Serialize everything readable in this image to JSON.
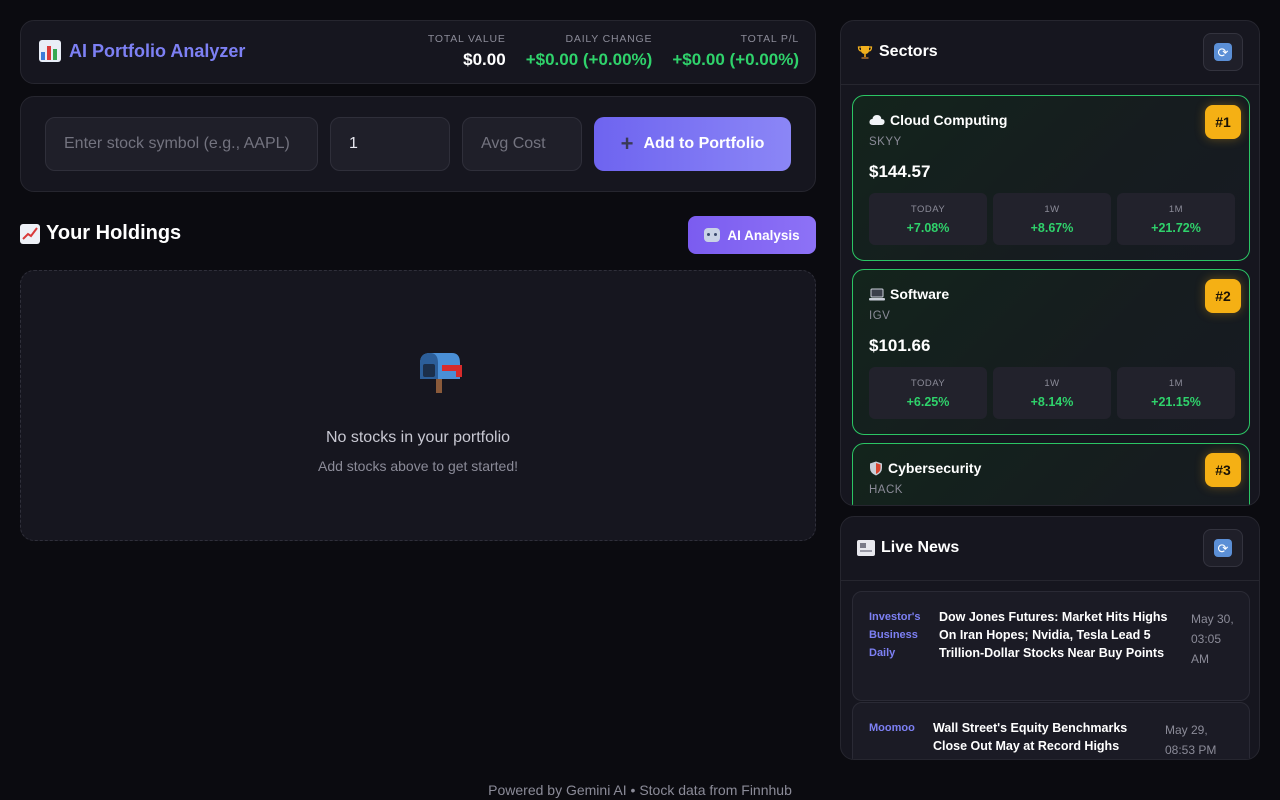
{
  "header": {
    "title": "AI Portfolio Analyzer",
    "stats": [
      {
        "label": "TOTAL VALUE",
        "value": "$0.00",
        "color": "#ffffff"
      },
      {
        "label": "DAILY CHANGE",
        "value": "+$0.00 (+0.00%)",
        "color": "#2fd26b"
      },
      {
        "label": "TOTAL P/L",
        "value": "+$0.00 (+0.00%)",
        "color": "#2fd26b"
      }
    ]
  },
  "add_form": {
    "symbol_placeholder": "Enter stock symbol (e.g., AAPL)",
    "quantity_value": "1",
    "avg_cost_placeholder": "Avg Cost",
    "add_button_label": "Add to Portfolio"
  },
  "holdings": {
    "title": "Your Holdings",
    "ai_button_label": "AI Analysis",
    "empty_title": "No stocks in your portfolio",
    "empty_subtitle": "Add stocks above to get started!"
  },
  "sectors": {
    "title": "Sectors",
    "items": [
      {
        "name": "Cloud Computing",
        "icon": "cloud-icon",
        "ticker": "SKYY",
        "price": "$144.57",
        "rank": "#1",
        "perf": [
          {
            "label": "TODAY",
            "value": "+7.08%"
          },
          {
            "label": "1W",
            "value": "+8.67%"
          },
          {
            "label": "1M",
            "value": "+21.72%"
          }
        ]
      },
      {
        "name": "Software",
        "icon": "laptop-icon",
        "ticker": "IGV",
        "price": "$101.66",
        "rank": "#2",
        "perf": [
          {
            "label": "TODAY",
            "value": "+6.25%"
          },
          {
            "label": "1W",
            "value": "+8.14%"
          },
          {
            "label": "1M",
            "value": "+21.15%"
          }
        ]
      },
      {
        "name": "Cybersecurity",
        "icon": "shield-icon",
        "ticker": "HACK",
        "rank": "#3"
      }
    ]
  },
  "news": {
    "title": "Live News",
    "items": [
      {
        "source": "Investor's Business Daily",
        "title": "Dow Jones Futures: Market Hits Highs On Iran Hopes; Nvidia, Tesla Lead 5 Trillion-Dollar Stocks Near Buy Points",
        "time": "May 30, 03:05 AM"
      },
      {
        "source": "Moomoo",
        "title": "Wall Street's Equity Benchmarks Close Out May at Record Highs",
        "time": "May 29, 08:53 PM"
      }
    ]
  },
  "footer": {
    "text": "Powered by Gemini AI • Stock data from Finnhub"
  },
  "colors": {
    "accent": "#7d80f4",
    "positive": "#2fd26b",
    "rank_badge": "#f5b014",
    "sector_border": "#2bc564"
  }
}
